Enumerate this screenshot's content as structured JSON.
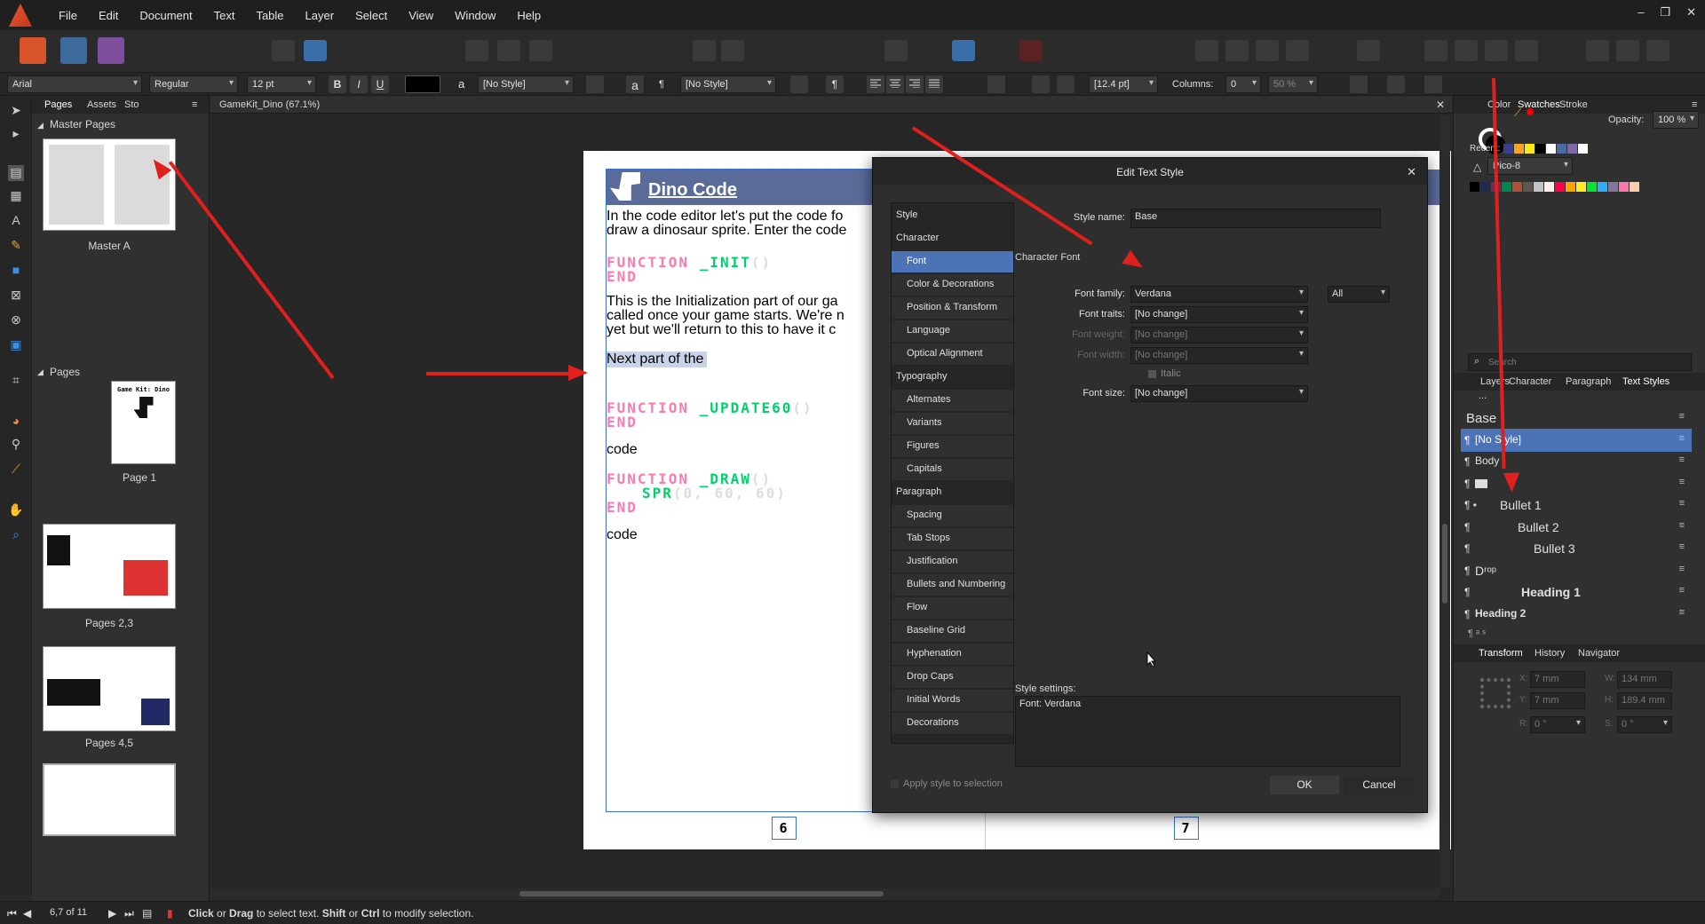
{
  "menubar": {
    "items": [
      "File",
      "Edit",
      "Document",
      "Text",
      "Table",
      "Layer",
      "Select",
      "View",
      "Window",
      "Help"
    ],
    "window_controls": [
      "–",
      "❐",
      "✕"
    ]
  },
  "context_bar": {
    "font_family": "Arial",
    "font_style": "Regular",
    "font_size": "12 pt",
    "bold": "B",
    "italic": "I",
    "underline": "U",
    "char_style": "[No Style]",
    "a_glyph": "a",
    "para_glyph": "¶",
    "para_style": "[No Style]",
    "leading": "[12.4 pt]",
    "columns_label": "Columns:",
    "columns_value": "0",
    "gutter": "50 %"
  },
  "pages_panel": {
    "tabs": [
      "Pages",
      "Assets",
      "Sto"
    ],
    "master_section": "Master Pages",
    "master_name": "Master A",
    "pages_section": "Pages",
    "thumb_cover_title": "Game Kit: Dino",
    "page_captions": [
      "Page 1",
      "Pages 2,3",
      "Pages 4,5"
    ]
  },
  "document": {
    "tab_title": "GameKit_Dino (67.1%)",
    "heading": "Dino Code",
    "para1_line1": "In the code editor let's put the code fo",
    "para1_line2": "draw a dinosaur sprite. Enter the code",
    "code1_fn": "FUNCTION",
    "code1_name": "_INIT",
    "code1_paren": "()",
    "code_end": "END",
    "para2_line1": "This is the Initialization part of our ga",
    "para2_line2": "called once your game starts. We're n",
    "para2_line3": "yet but we'll return to this to have it c",
    "selected_text": "Next part of the ",
    "code2_name": "_UPDATE60",
    "code_word": "code",
    "code3_name": "_DRAW",
    "code3_spr": "SPR",
    "code3_args": "(0, 60, 60)",
    "page_numbers": [
      "6",
      "7"
    ]
  },
  "dialog": {
    "title": "Edit Text Style",
    "close": "✕",
    "style_list": [
      {
        "label": "Style",
        "sub": false,
        "selected": false
      },
      {
        "label": "Character",
        "sub": false,
        "selected": false
      },
      {
        "label": "Font",
        "sub": true,
        "selected": true
      },
      {
        "label": "Color & Decorations",
        "sub": true,
        "selected": false
      },
      {
        "label": "Position & Transform",
        "sub": true,
        "selected": false
      },
      {
        "label": "Language",
        "sub": true,
        "selected": false
      },
      {
        "label": "Optical Alignment",
        "sub": true,
        "selected": false
      },
      {
        "label": "Typography",
        "sub": false,
        "selected": false
      },
      {
        "label": "Alternates",
        "sub": true,
        "selected": false
      },
      {
        "label": "Variants",
        "sub": true,
        "selected": false
      },
      {
        "label": "Figures",
        "sub": true,
        "selected": false
      },
      {
        "label": "Capitals",
        "sub": true,
        "selected": false
      },
      {
        "label": "Paragraph",
        "sub": false,
        "selected": false
      },
      {
        "label": "Spacing",
        "sub": true,
        "selected": false
      },
      {
        "label": "Tab Stops",
        "sub": true,
        "selected": false
      },
      {
        "label": "Justification",
        "sub": true,
        "selected": false
      },
      {
        "label": "Bullets and Numbering",
        "sub": true,
        "selected": false
      },
      {
        "label": "Flow",
        "sub": true,
        "selected": false
      },
      {
        "label": "Baseline Grid",
        "sub": true,
        "selected": false
      },
      {
        "label": "Hyphenation",
        "sub": true,
        "selected": false
      },
      {
        "label": "Drop Caps",
        "sub": true,
        "selected": false
      },
      {
        "label": "Initial Words",
        "sub": true,
        "selected": false
      },
      {
        "label": "Decorations",
        "sub": true,
        "selected": false
      }
    ],
    "style_name_label": "Style name:",
    "style_name_value": "Base",
    "section_title": "Character Font",
    "font_family_label": "Font family:",
    "font_family_value": "Verdana",
    "font_family_filter": "All",
    "font_traits_label": "Font traits:",
    "font_traits_value": "[No change]",
    "font_weight_label": "Font weight:",
    "font_weight_value": "[No change]",
    "font_width_label": "Font width:",
    "font_width_value": "[No change]",
    "italic_label": "Italic",
    "font_size_label": "Font size:",
    "font_size_value": "[No change]",
    "settings_label": "Style settings:",
    "settings_value": "Font: Verdana",
    "apply_label": "Apply style to selection",
    "ok": "OK",
    "cancel": "Cancel"
  },
  "right_panel": {
    "color_tabs": [
      "Color",
      "Swatches",
      "Stroke"
    ],
    "opacity_label": "Opacity:",
    "opacity_value": "100 %",
    "recent_label": "Recent:",
    "palette_name": "Pico-8",
    "recent_colors": [
      "#3a3f8c",
      "#f5a623",
      "#f8e71c",
      "#000000",
      "#ffffff",
      "#4a6aa8",
      "#7a6aa8",
      "#ffffff"
    ],
    "palette_colors": [
      "#000000",
      "#1d2b53",
      "#7e2553",
      "#008751",
      "#ab5236",
      "#5f574f",
      "#c2c3c7",
      "#fff1e8",
      "#ff004d",
      "#ffa300",
      "#ffec27",
      "#00e436",
      "#29adff",
      "#83769c",
      "#ff77a8",
      "#ffccaa"
    ],
    "search_placeholder": "Search",
    "style_tabs": [
      "Layers",
      "Character",
      "Paragraph",
      "Text Styles"
    ],
    "breadcrumb": "...",
    "text_styles": [
      {
        "label": "Base",
        "pilcrow": "",
        "selected": false
      },
      {
        "label": "[No Style]",
        "pilcrow": "¶",
        "selected": true
      },
      {
        "label": "Body",
        "pilcrow": "¶",
        "selected": false
      },
      {
        "label": "",
        "pilcrow": "¶",
        "selected": false
      },
      {
        "label": "Bullet 1",
        "pilcrow": "¶ •",
        "selected": false
      },
      {
        "label": "Bullet 2",
        "pilcrow": "¶",
        "selected": false
      },
      {
        "label": "Bullet 3",
        "pilcrow": "¶",
        "selected": false
      },
      {
        "label": "Dʳᵒᵖ",
        "pilcrow": "¶",
        "selected": false
      },
      {
        "label": "Heading 1",
        "pilcrow": "¶",
        "selected": false
      },
      {
        "label": "Heading 2",
        "pilcrow": "¶",
        "selected": false
      }
    ],
    "transform_tabs": [
      "Transform",
      "History",
      "Navigator"
    ],
    "x_label": "X:",
    "x_value": "7 mm",
    "y_label": "Y:",
    "y_value": "7 mm",
    "w_label": "W:",
    "w_value": "134 mm",
    "h_label": "H:",
    "h_value": "189.4 mm",
    "r_label": "R:",
    "r_value": "0 °",
    "s_label": "S:",
    "s_value": "0 °"
  },
  "status_bar": {
    "page_indicator": "6,7 of 11",
    "hint_click": "Click",
    "hint_or": " or ",
    "hint_drag": "Drag",
    "hint_mid": " to select text. ",
    "hint_shift": "Shift",
    "hint_or2": " or ",
    "hint_ctrl": "Ctrl",
    "hint_end": " to modify selection."
  }
}
